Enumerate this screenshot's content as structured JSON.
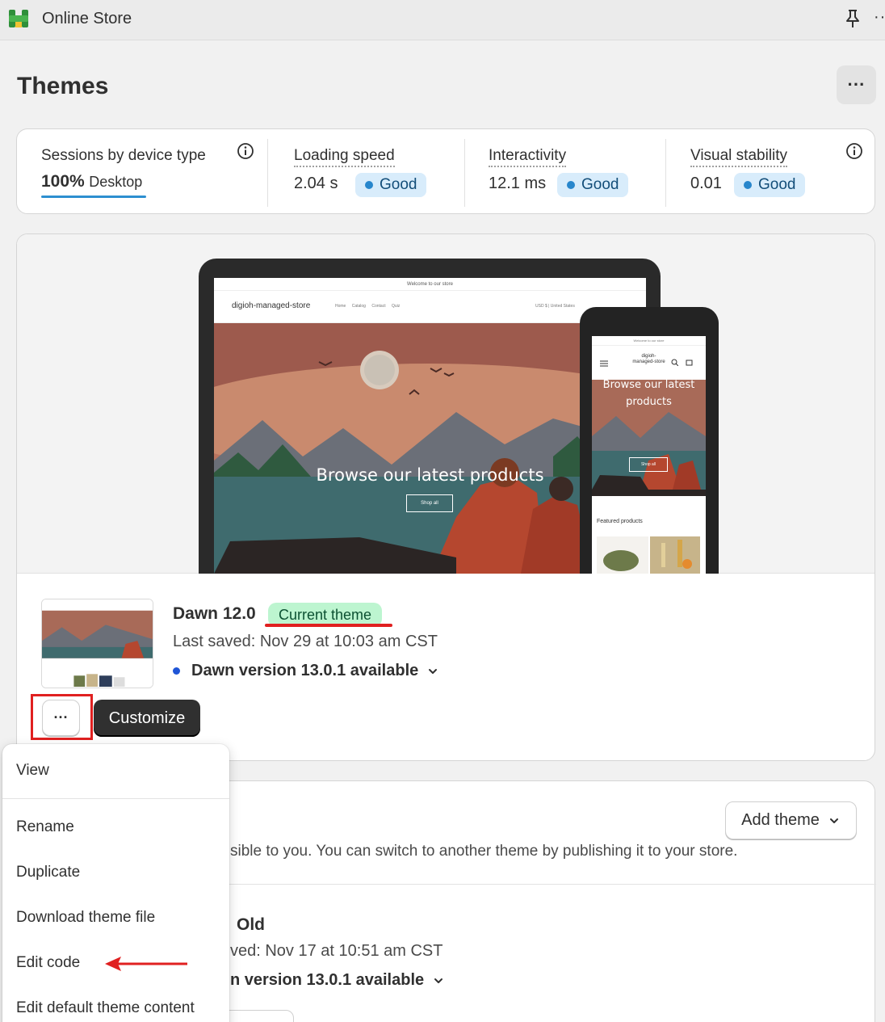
{
  "app": {
    "title": "Online Store",
    "more_label": "··"
  },
  "page": {
    "title": "Themes",
    "more_label": "···"
  },
  "stats": {
    "sessions": {
      "label": "Sessions by device type",
      "percent": "100%",
      "device": "Desktop"
    },
    "loading": {
      "label": "Loading speed",
      "value": "2.04 s",
      "badge": "Good"
    },
    "interactivity": {
      "label": "Interactivity",
      "value": "12.1 ms",
      "badge": "Good"
    },
    "stability": {
      "label": "Visual stability",
      "value": "0.01",
      "badge": "Good"
    }
  },
  "preview": {
    "desktop": {
      "announcement": "Welcome to our store",
      "store_name": "digioh-managed-store",
      "nav_links": "Home Catalog Contact Quiz",
      "region": "USD $ | United States",
      "hero_text": "Browse our latest products",
      "hero_button": "Shop all"
    },
    "mobile": {
      "announcement": "Welcome to our store",
      "store_name": "digioh-managed-store",
      "hero_text": "Browse our latest products",
      "hero_button": "Shop all",
      "featured": "Featured products"
    }
  },
  "current_theme": {
    "name": "Dawn 12.0",
    "badge": "Current theme",
    "last_saved": "Last saved: Nov 29 at 10:03 am CST",
    "version_notice": "Dawn version 13.0.1 available",
    "more_label": "···",
    "customize_label": "Customize"
  },
  "library": {
    "add_theme_label": "Add theme",
    "description": "sible to you. You can switch to another theme by publishing it to your store.",
    "old_theme": {
      "name": "Old",
      "last_saved": "ved: Nov 17 at 10:51 am CST",
      "version_notice": "n version 13.0.1 available"
    }
  },
  "menu": {
    "items": [
      "View",
      "Rename",
      "Duplicate",
      "Download theme file",
      "Edit code",
      "Edit default theme content"
    ]
  },
  "colors": {
    "good_badge": "#d8ecfb",
    "current_badge": "#bdf5d0",
    "annotation_red": "#e02020",
    "primary_button": "#303030"
  }
}
